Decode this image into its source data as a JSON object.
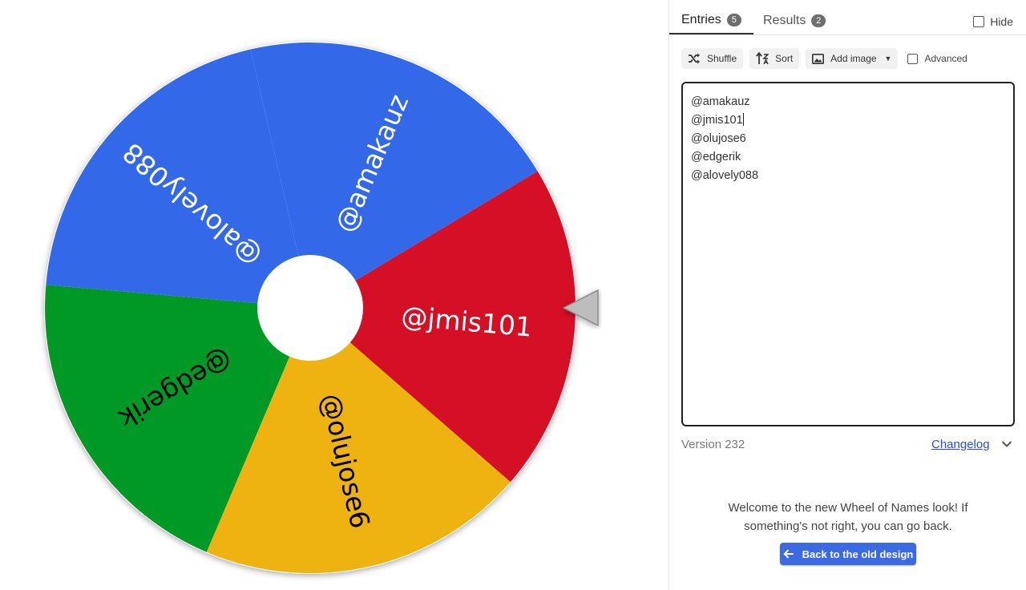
{
  "tabs": [
    {
      "label": "Entries",
      "count": "5"
    },
    {
      "label": "Results",
      "count": "2"
    }
  ],
  "hide_label": "Hide",
  "toolbar": {
    "shuffle_label": "Shuffle",
    "sort_label": "Sort",
    "add_image_label": "Add image",
    "advanced_label": "Advanced"
  },
  "entries": [
    "@amakauz",
    "@jmis101",
    "@olujose6",
    "@edgerik",
    "@alovely088"
  ],
  "version_label": "Version 232",
  "changelog_label": "Changelog",
  "welcome_line1": "Welcome to the new Wheel of Names look! If",
  "welcome_line2": "something's not right, you can go back.",
  "back_button_label": "Back to the old design",
  "wheel": {
    "segments": [
      {
        "label": "@amakauz",
        "color": "#3369e8",
        "text_color": "#ffffff"
      },
      {
        "label": "@jmis101",
        "color": "#d50f25",
        "text_color": "#ffffff"
      },
      {
        "label": "@olujose6",
        "color": "#eeb211",
        "text_color": "#000000"
      },
      {
        "label": "@edgerik",
        "color": "#009925",
        "text_color": "#000000"
      },
      {
        "label": "@alovely088",
        "color": "#3369e8",
        "text_color": "#ffffff"
      }
    ]
  },
  "colors": {
    "accent": "#3b6ae3",
    "link": "#2a4bd6"
  }
}
